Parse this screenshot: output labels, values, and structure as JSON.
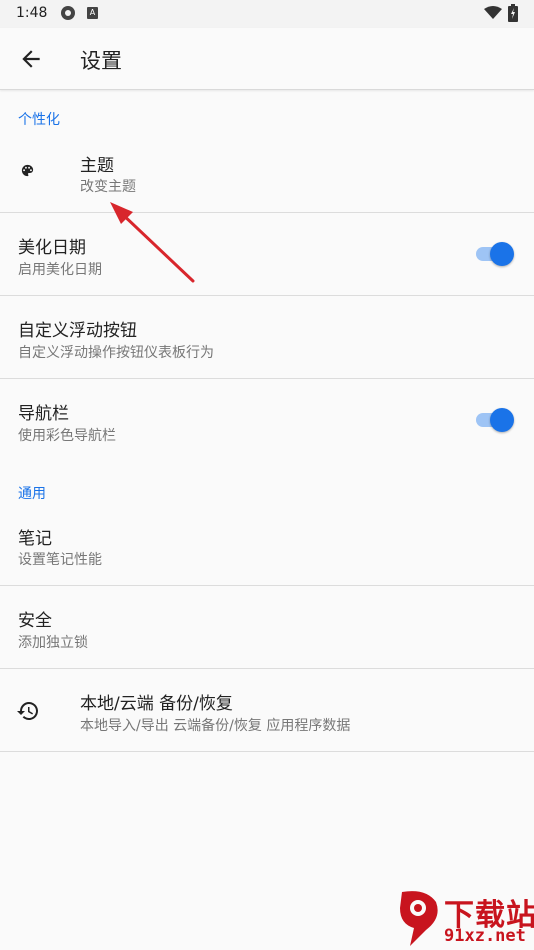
{
  "status_bar": {
    "time": "1:48",
    "icon_a": "A"
  },
  "app_bar": {
    "title": "设置"
  },
  "sections": {
    "personalize": "个性化",
    "general": "通用"
  },
  "items": {
    "theme": {
      "title": "主题",
      "subtitle": "改变主题"
    },
    "beautify_date": {
      "title": "美化日期",
      "subtitle": "启用美化日期",
      "enabled": true
    },
    "custom_fab": {
      "title": "自定义浮动按钮",
      "subtitle": "自定义浮动操作按钮仪表板行为"
    },
    "nav_bar": {
      "title": "导航栏",
      "subtitle": "使用彩色导航栏",
      "enabled": true
    },
    "notes": {
      "title": "笔记",
      "subtitle": "设置笔记性能"
    },
    "security": {
      "title": "安全",
      "subtitle": "添加独立锁"
    },
    "backup": {
      "title": "本地/云端 备份/恢复",
      "subtitle": "本地导入/导出 云端备份/恢复 应用程序数据"
    }
  },
  "watermark": {
    "cn": "下载站",
    "en": "91xz.net"
  },
  "colors": {
    "accent": "#1a73e8",
    "track": "#9ec4f5",
    "annotation": "#d8262c"
  }
}
